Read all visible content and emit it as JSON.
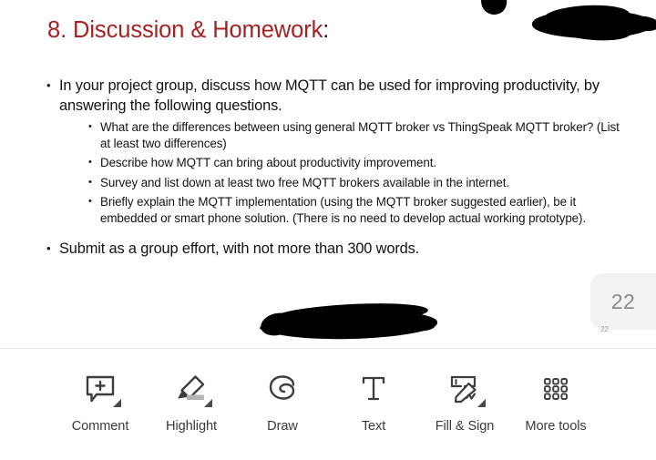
{
  "document": {
    "title_main": "8. Discussion & Homework",
    "title_colon": ":",
    "title_color": "#a82020",
    "body_color": "#131313",
    "bullets": [
      {
        "text": "In your project group, discuss how MQTT can be used for improving productivity, by answering the following questions.",
        "sub": [
          "What are the differences between using general MQTT broker vs ThingSpeak MQTT broker? (List at least two differences)",
          "Describe how MQTT can bring about productivity improvement.",
          "Survey and list down at least two free MQTT brokers available in the internet.",
          "Briefly explain the MQTT implementation (using the MQTT broker suggested earlier), be it embedded or smart phone solution. (There is no need to develop actual working prototype)."
        ]
      },
      {
        "text": "Submit as a group effort, with not more than 300 words.",
        "sub": []
      }
    ]
  },
  "page_indicator": {
    "number": "22",
    "sub_number": "22",
    "background": "#f2f2f2",
    "text_color": "#8a8a8a"
  },
  "toolbar": {
    "items": [
      {
        "label": "Comment",
        "icon": "comment-add-icon",
        "has_caret": true
      },
      {
        "label": "Highlight",
        "icon": "highlighter-icon",
        "has_caret": true
      },
      {
        "label": "Draw",
        "icon": "draw-scribble-icon",
        "has_caret": false
      },
      {
        "label": "Text",
        "icon": "text-t-icon",
        "has_caret": false
      },
      {
        "label": "Fill & Sign",
        "icon": "fill-and-sign-icon",
        "has_caret": true
      },
      {
        "label": "More tools",
        "icon": "grid-apps-icon",
        "has_caret": false
      }
    ]
  }
}
